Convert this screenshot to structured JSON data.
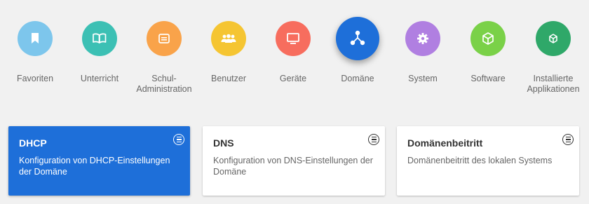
{
  "categories": [
    {
      "label": "Favoriten",
      "color": "#7dc6ec",
      "icon": "bookmark-icon"
    },
    {
      "label": "Unterricht",
      "color": "#3cc0b4",
      "icon": "book-icon"
    },
    {
      "label": "Schul-\nAdministration",
      "color": "#f9a34a",
      "icon": "server-icon"
    },
    {
      "label": "Benutzer",
      "color": "#f5c532",
      "icon": "users-icon"
    },
    {
      "label": "Geräte",
      "color": "#f76d5e",
      "icon": "monitor-icon"
    },
    {
      "label": "Domäne",
      "color": "#1e6fd9",
      "icon": "share-icon",
      "active": true
    },
    {
      "label": "System",
      "color": "#b07fe1",
      "icon": "gear-icon"
    },
    {
      "label": "Software",
      "color": "#7ad148",
      "icon": "cube-icon"
    },
    {
      "label": "Installierte\nApplikationen",
      "color": "#2fa869",
      "icon": "package-icon"
    }
  ],
  "cards": [
    {
      "title": "DHCP",
      "description": "Konfiguration von DHCP-Einstellungen der Domäne",
      "active": true
    },
    {
      "title": "DNS",
      "description": "Konfiguration von DNS-Einstellungen der Domäne"
    },
    {
      "title": "Domänenbeitritt",
      "description": "Domänenbeitritt des lokalen Systems"
    }
  ]
}
